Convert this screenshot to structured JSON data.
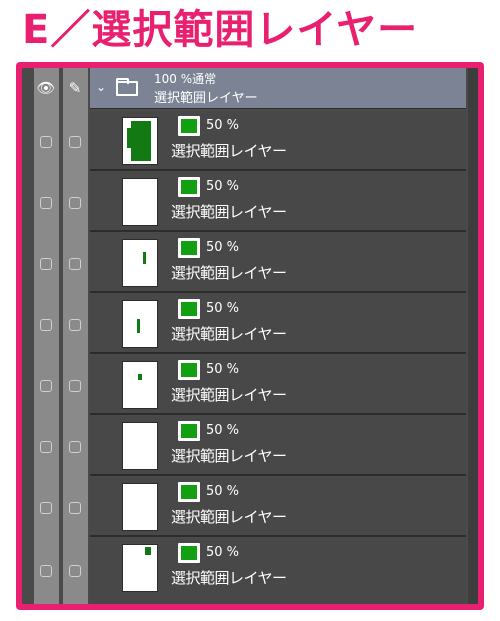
{
  "title": "E／選択範囲レイヤー",
  "panel": {
    "folder": {
      "mode_label": "100 %通常",
      "name": "選択範囲レイヤー",
      "eye_icon": "eye-icon",
      "pen_icon": "pencil-icon",
      "chevron": "chevron-down-icon",
      "folder_icon": "folder-icon"
    },
    "layers": [
      {
        "opacity": "50 %",
        "name": "選択範囲レイヤー"
      },
      {
        "opacity": "50 %",
        "name": "選択範囲レイヤー"
      },
      {
        "opacity": "50 %",
        "name": "選択範囲レイヤー"
      },
      {
        "opacity": "50 %",
        "name": "選択範囲レイヤー"
      },
      {
        "opacity": "50 %",
        "name": "選択範囲レイヤー"
      },
      {
        "opacity": "50 %",
        "name": "選択範囲レイヤー"
      },
      {
        "opacity": "50 %",
        "name": "選択範囲レイヤー"
      },
      {
        "opacity": "50 %",
        "name": "選択範囲レイヤー"
      }
    ]
  },
  "colors": {
    "accent_pink": "#e8206f",
    "selection_green": "#129f12",
    "header_bg": "#7b8394",
    "panel_bg": "#4a4a4a"
  }
}
